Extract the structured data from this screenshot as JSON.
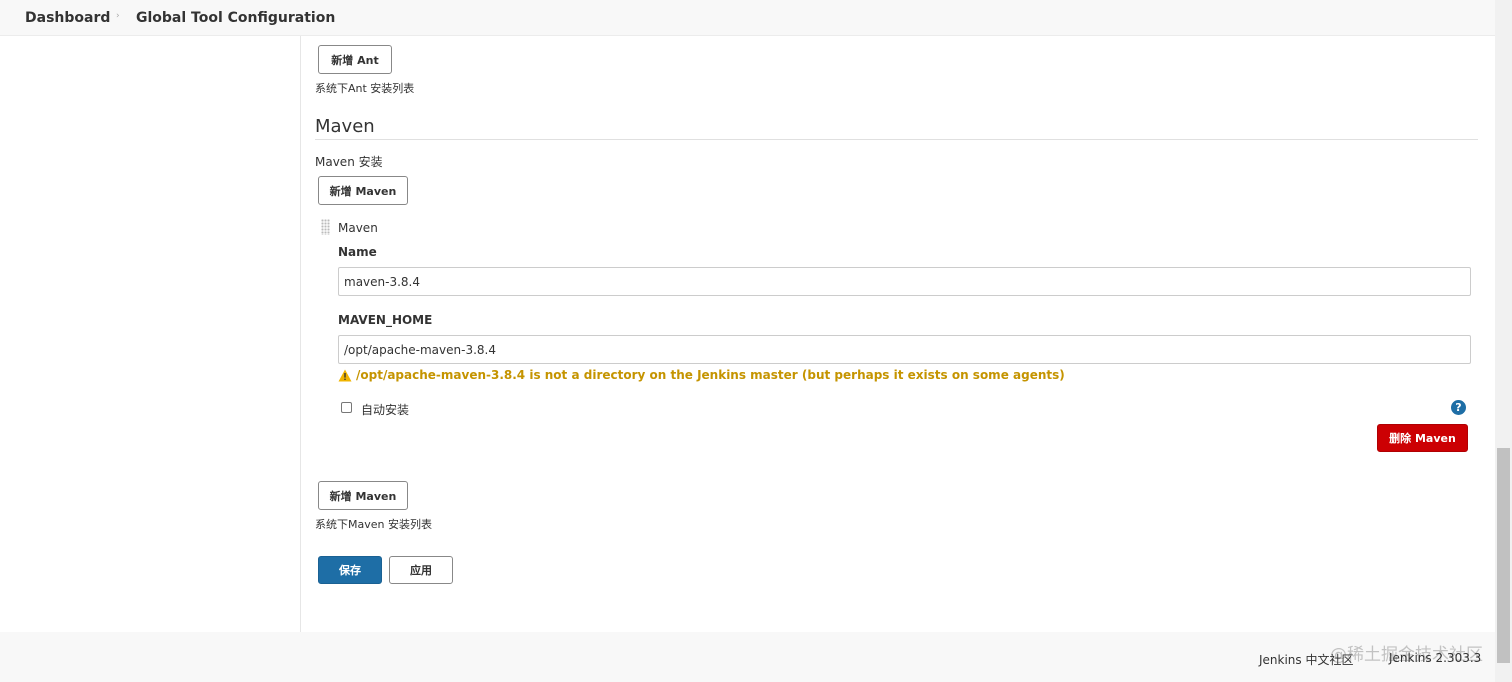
{
  "breadcrumb": {
    "dashboard": "Dashboard",
    "separator": "›",
    "page": "Global Tool Configuration"
  },
  "ant": {
    "add_button": "新增 Ant",
    "list_caption": "系统下Ant 安装列表"
  },
  "maven": {
    "section_title": "Maven",
    "installations_label": "Maven 安装",
    "add_button_top": "新增 Maven",
    "installation": {
      "header": "Maven",
      "name_label": "Name",
      "name_value": "maven-3.8.4",
      "home_label": "MAVEN_HOME",
      "home_value": "/opt/apache-maven-3.8.4",
      "warning": "/opt/apache-maven-3.8.4 is not a directory on the Jenkins master (but perhaps it exists on some agents)",
      "auto_install_label": "自动安装",
      "auto_install_checked": false,
      "help": "?",
      "delete_button": "删除 Maven"
    },
    "add_button_bottom": "新增 Maven",
    "list_caption": "系统下Maven 安装列表"
  },
  "actions": {
    "save": "保存",
    "apply": "应用"
  },
  "footer": {
    "community_link": "Jenkins 中文社区",
    "version": "Jenkins 2.303.3",
    "watermark": "@稀土掘金技术社区"
  },
  "colors": {
    "primary": "#1e6ea6",
    "danger": "#cc0003",
    "warning": "#c59400"
  }
}
